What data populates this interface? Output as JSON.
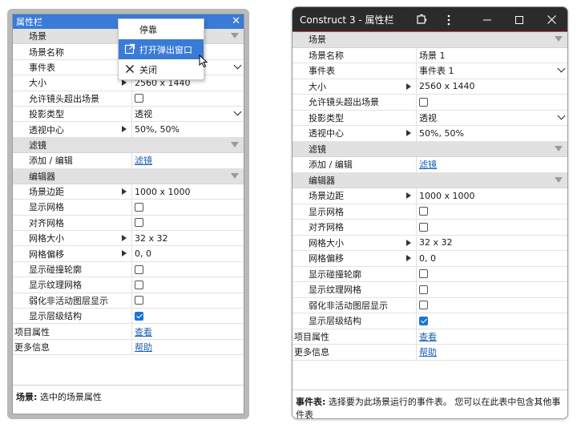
{
  "left_panel": {
    "title": "属性栏",
    "rows": [
      {
        "type": "section",
        "label": "场景"
      },
      {
        "type": "prop",
        "label": "场景名称",
        "value": ""
      },
      {
        "type": "prop",
        "label": "事件表",
        "value": "",
        "control": "dropdown"
      },
      {
        "type": "prop",
        "label": "大小",
        "value": "2560 x 1440",
        "expand": true
      },
      {
        "type": "prop",
        "label": "允许镜头超出场景",
        "control": "checkbox",
        "checked": false
      },
      {
        "type": "prop",
        "label": "投影类型",
        "value": "透视",
        "control": "dropdown"
      },
      {
        "type": "prop",
        "label": "透视中心",
        "value": "50%, 50%",
        "expand": true
      },
      {
        "type": "section",
        "label": "滤镜"
      },
      {
        "type": "prop",
        "label": "添加 / 编辑",
        "value": "滤镜",
        "control": "link"
      },
      {
        "type": "section",
        "label": "编辑器"
      },
      {
        "type": "prop",
        "label": "场景边距",
        "value": "1000 x 1000",
        "expand": true
      },
      {
        "type": "prop",
        "label": "显示网格",
        "control": "checkbox",
        "checked": false
      },
      {
        "type": "prop",
        "label": "对齐网格",
        "control": "checkbox",
        "checked": false
      },
      {
        "type": "prop",
        "label": "网格大小",
        "value": "32 x 32",
        "expand": true
      },
      {
        "type": "prop",
        "label": "网格偏移",
        "value": "0, 0",
        "expand": true
      },
      {
        "type": "prop",
        "label": "显示碰撞轮廓",
        "control": "checkbox",
        "checked": false
      },
      {
        "type": "prop",
        "label": "显示纹理网格",
        "control": "checkbox",
        "checked": false
      },
      {
        "type": "prop",
        "label": "弱化非活动图层显示",
        "control": "checkbox",
        "checked": false
      },
      {
        "type": "prop",
        "label": "显示层级结构",
        "control": "checkbox",
        "checked": true
      },
      {
        "type": "top",
        "label": "项目属性",
        "value": "查看",
        "control": "link"
      },
      {
        "type": "top",
        "label": "更多信息",
        "value": "帮助",
        "control": "link"
      }
    ],
    "status_key": "场景:",
    "status_text": " 选中的场景属性"
  },
  "context_menu": {
    "items": [
      {
        "label": "停靠",
        "icon": ""
      },
      {
        "label": "打开弹出窗口",
        "icon": "popout-icon",
        "highlighted": true
      },
      {
        "label": "关闭",
        "icon": "close-icon"
      }
    ]
  },
  "right_window": {
    "title": "Construct 3 - 属性栏",
    "rows": [
      {
        "type": "section",
        "label": "场景"
      },
      {
        "type": "prop",
        "label": "场景名称",
        "value": "场景 1"
      },
      {
        "type": "prop",
        "label": "事件表",
        "value": "事件表 1",
        "control": "dropdown"
      },
      {
        "type": "prop",
        "label": "大小",
        "value": "2560 x 1440",
        "expand": true
      },
      {
        "type": "prop",
        "label": "允许镜头超出场景",
        "control": "checkbox",
        "checked": false
      },
      {
        "type": "prop",
        "label": "投影类型",
        "value": "透视",
        "control": "dropdown"
      },
      {
        "type": "prop",
        "label": "透视中心",
        "value": "50%, 50%",
        "expand": true
      },
      {
        "type": "section",
        "label": "滤镜"
      },
      {
        "type": "prop",
        "label": "添加 / 编辑",
        "value": "滤镜",
        "control": "link"
      },
      {
        "type": "section",
        "label": "编辑器"
      },
      {
        "type": "prop",
        "label": "场景边距",
        "value": "1000 x 1000",
        "expand": true
      },
      {
        "type": "prop",
        "label": "显示网格",
        "control": "checkbox",
        "checked": false
      },
      {
        "type": "prop",
        "label": "对齐网格",
        "control": "checkbox",
        "checked": false
      },
      {
        "type": "prop",
        "label": "网格大小",
        "value": "32 x 32",
        "expand": true
      },
      {
        "type": "prop",
        "label": "网格偏移",
        "value": "0, 0",
        "expand": true
      },
      {
        "type": "prop",
        "label": "显示碰撞轮廓",
        "control": "checkbox",
        "checked": false
      },
      {
        "type": "prop",
        "label": "显示纹理网格",
        "control": "checkbox",
        "checked": false
      },
      {
        "type": "prop",
        "label": "弱化非活动图层显示",
        "control": "checkbox",
        "checked": false
      },
      {
        "type": "prop",
        "label": "显示层级结构",
        "control": "checkbox",
        "checked": true
      },
      {
        "type": "top",
        "label": "项目属性",
        "value": "查看",
        "control": "link"
      },
      {
        "type": "top",
        "label": "更多信息",
        "value": "帮助",
        "control": "link"
      }
    ],
    "status_key": "事件表:",
    "status_text": " 选择要为此场景运行的事件表。 您可以在此表中包含其他事件表"
  },
  "colors": {
    "accent": "#3a7bd5",
    "titlebar_dark": "#2b2b2b",
    "section_bg": "#e1e1e1",
    "link": "#1a5fb4"
  }
}
